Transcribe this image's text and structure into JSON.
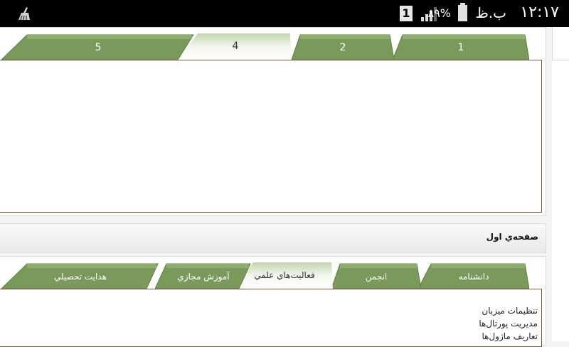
{
  "status_bar": {
    "time": "١٢:١٧",
    "ampm": "ب.ظ",
    "battery_percent": "٨٩%",
    "sim_label": "1",
    "icons": [
      "clean-icon",
      "sim-icon",
      "signal-icon",
      "battery-icon"
    ]
  },
  "top_tabs": {
    "tabs": [
      {
        "label": "1",
        "active": false
      },
      {
        "label": "2",
        "active": false
      },
      {
        "label": "4",
        "active": true
      },
      {
        "label": "5",
        "active": false
      }
    ]
  },
  "section": {
    "title": "صفحه‌ي اول"
  },
  "bottom_tabs": {
    "tabs": [
      {
        "label": "دانشنامه",
        "active": false
      },
      {
        "label": "انجمن",
        "active": false
      },
      {
        "label": "فعاليت‌هاي علمي",
        "active": true
      },
      {
        "label": "آموزش مجازي",
        "active": false
      },
      {
        "label": "هدايت تحصيلي",
        "active": false
      }
    ]
  },
  "menu": {
    "items": [
      "تنظيمات ميزبان",
      "مديريت پورتال‌ها",
      "تعاريف ماژول‌ها"
    ]
  },
  "colors": {
    "tab_green": "#7a9a5c",
    "tab_active": "#e8efe0",
    "border_brown": "#7a5a2f"
  }
}
